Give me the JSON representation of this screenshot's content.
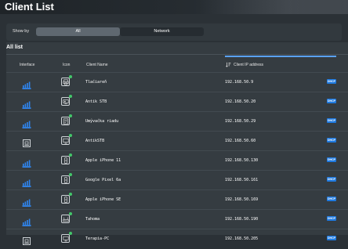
{
  "header": {
    "title": "Client List"
  },
  "showby": {
    "label": "Show by",
    "options": [
      "All",
      "Network"
    ],
    "selected": "All"
  },
  "section_title": "All list",
  "columns": {
    "interface": "Interface",
    "icon": "Icon",
    "client_name": "Client Name",
    "client_ip": "Client IP address"
  },
  "colors": {
    "accent": "#1f7ae0",
    "online_dot": "#43c76a",
    "sort_underline": "#5aa2ff"
  },
  "rows": [
    {
      "interface": "wifi-5ghz",
      "icon": "printer-icon",
      "name": "Tlačiareň",
      "ip": "192.168.50.9",
      "type": "DHCP"
    },
    {
      "interface": "wifi-5ghz",
      "icon": "tv-box-icon",
      "name": "Antik STB",
      "ip": "192.168.50.20",
      "type": "DHCP"
    },
    {
      "interface": "wifi-2.4ghz",
      "icon": "dishwasher-icon",
      "name": "Umývačka riadu",
      "ip": "192.168.50.29",
      "type": "DHCP"
    },
    {
      "interface": "wired",
      "icon": "tv-icon",
      "name": "AntikSTB",
      "ip": "192.168.50.60",
      "type": "DHCP"
    },
    {
      "interface": "wifi-5ghz",
      "icon": "phone-icon",
      "name": "Apple iPhone 11",
      "ip": "192.168.50.130",
      "type": "DHCP"
    },
    {
      "interface": "wifi-5ghz",
      "icon": "phone-icon",
      "name": "Google Pixel 6a",
      "ip": "192.168.50.161",
      "type": "DHCP"
    },
    {
      "interface": "wifi-5ghz",
      "icon": "phone-icon",
      "name": "Apple iPhone SE",
      "ip": "192.168.50.169",
      "type": "DHCP"
    },
    {
      "interface": "wifi-2.4ghz",
      "icon": "router-icon",
      "name": "Tahoma",
      "ip": "192.168.50.190",
      "type": "DHCP"
    },
    {
      "interface": "wired",
      "icon": "pc-icon",
      "name": "Terapia-PC",
      "ip": "192.168.50.205",
      "type": "DHCP"
    }
  ]
}
